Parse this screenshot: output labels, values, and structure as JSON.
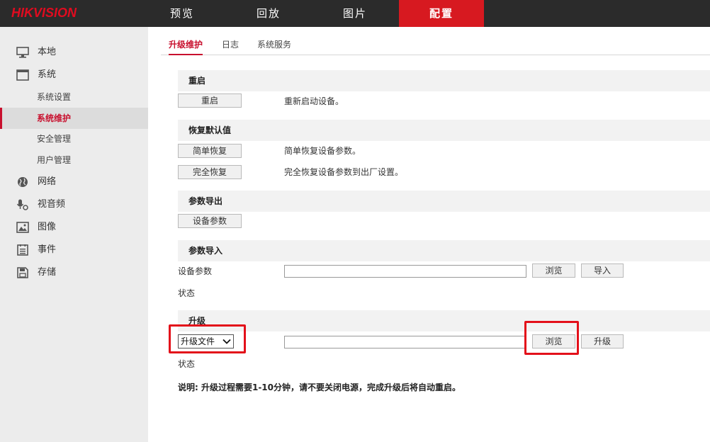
{
  "brand": {
    "logo_text": "HIKVISION",
    "accent": "#d71920",
    "topbar_bg": "#2b2b2b",
    "highlight": "#e3101a"
  },
  "nav": [
    {
      "label": "预览",
      "active": false
    },
    {
      "label": "回放",
      "active": false
    },
    {
      "label": "图片",
      "active": false
    },
    {
      "label": "配置",
      "active": true
    }
  ],
  "sidebar": {
    "items": [
      {
        "label": "本地",
        "icon": "monitor-icon"
      },
      {
        "label": "系统",
        "icon": "window-icon"
      },
      {
        "label": "网络",
        "icon": "globe-icon"
      },
      {
        "label": "视音频",
        "icon": "microphone-icon"
      },
      {
        "label": "图像",
        "icon": "image-icon"
      },
      {
        "label": "事件",
        "icon": "list-icon"
      },
      {
        "label": "存储",
        "icon": "floppy-icon"
      }
    ],
    "sub_items": [
      {
        "label": "系统设置",
        "active": false
      },
      {
        "label": "系统维护",
        "active": true
      },
      {
        "label": "安全管理",
        "active": false
      },
      {
        "label": "用户管理",
        "active": false
      }
    ]
  },
  "tabs": [
    {
      "label": "升级维护",
      "active": true
    },
    {
      "label": "日志",
      "active": false
    },
    {
      "label": "系统服务",
      "active": false
    }
  ],
  "restart": {
    "title": "重启",
    "button": "重启",
    "desc": "重新启动设备。"
  },
  "restore": {
    "title": "恢复默认值",
    "simple_button": "简单恢复",
    "simple_desc": "简单恢复设备参数。",
    "full_button": "完全恢复",
    "full_desc": "完全恢复设备参数到出厂设置。"
  },
  "export": {
    "title": "参数导出",
    "button": "设备参数"
  },
  "import": {
    "title": "参数导入",
    "field_label": "设备参数",
    "file_value": "",
    "browse_button": "浏览",
    "import_button": "导入",
    "status_label": "状态"
  },
  "upgrade": {
    "title": "升级",
    "select_value": "升级文件",
    "file_value": "",
    "browse_button": "浏览",
    "upgrade_button": "升级",
    "status_label": "状态",
    "note": "说明: 升级过程需要1-10分钟，请不要关闭电源，完成升级后将自动重启。"
  }
}
